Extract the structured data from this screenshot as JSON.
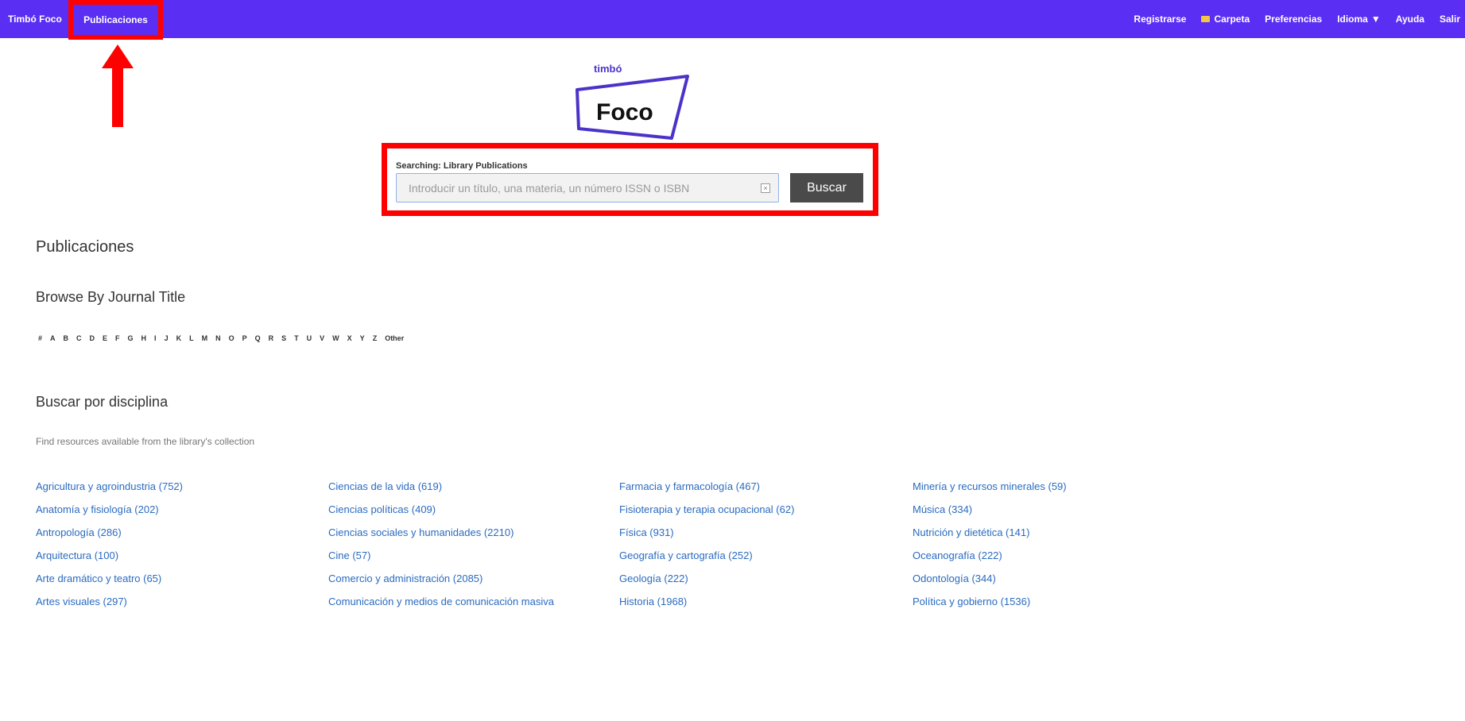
{
  "navbar": {
    "brand": "Timbó Foco",
    "publications": "Publicaciones",
    "right": {
      "register": "Registrarse",
      "folder": "Carpeta",
      "preferences": "Preferencias",
      "language": "Idioma",
      "help": "Ayuda",
      "logout": "Salir"
    }
  },
  "logo": {
    "small": "timbó",
    "large": "Foco"
  },
  "search": {
    "searching_label": "Searching: Library Publications",
    "placeholder": "Introducir un título, una materia, un número ISSN o ISBN",
    "clear": "×",
    "button": "Buscar"
  },
  "headings": {
    "publications": "Publicaciones",
    "browse": "Browse By Journal Title",
    "discipline": "Buscar por disciplina",
    "discipline_sub": "Find resources available from the library's collection"
  },
  "letters": [
    "#",
    "A",
    "B",
    "C",
    "D",
    "E",
    "F",
    "G",
    "H",
    "I",
    "J",
    "K",
    "L",
    "M",
    "N",
    "O",
    "P",
    "Q",
    "R",
    "S",
    "T",
    "U",
    "V",
    "W",
    "X",
    "Y",
    "Z",
    "Other"
  ],
  "disciplines": [
    "Agricultura y agroindustria (752)",
    "Ciencias de la vida (619)",
    "Farmacia y farmacología (467)",
    "Minería y recursos minerales (59)",
    "Anatomía y fisiología (202)",
    "Ciencias políticas (409)",
    "Fisioterapia y terapia ocupacional (62)",
    "Música (334)",
    "Antropología (286)",
    "Ciencias sociales y humanidades (2210)",
    "Física (931)",
    "Nutrición y dietética (141)",
    "Arquitectura (100)",
    "Cine (57)",
    "Geografía y cartografía (252)",
    "Oceanografía (222)",
    "Arte dramático y teatro (65)",
    "Comercio y administración (2085)",
    "Geología (222)",
    "Odontología (344)",
    "Artes visuales (297)",
    "Comunicación y medios de comunicación masiva",
    "Historia (1968)",
    "Política y gobierno (1536)"
  ],
  "colors": {
    "navbar": "#5a2ef3",
    "highlight": "#ff0000",
    "link": "#2a6bc0",
    "button": "#4a4a4a"
  }
}
